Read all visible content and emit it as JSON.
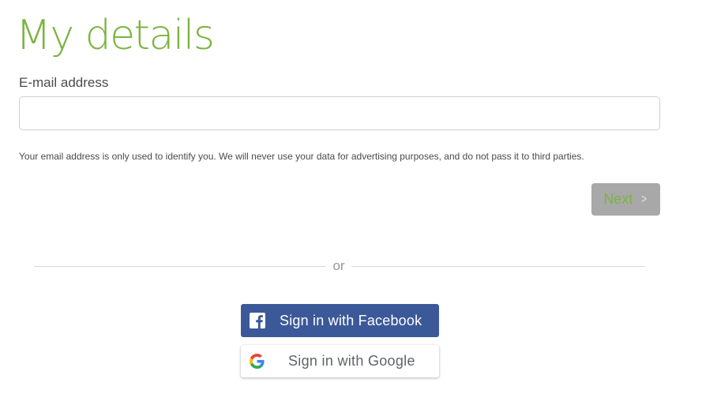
{
  "page": {
    "title": "My details"
  },
  "email": {
    "label": "E-mail address",
    "value": "",
    "placeholder": ""
  },
  "privacy_note": "Your email address is only used to identify you. We will never use your data for advertising purposes, and do not pass it to third parties.",
  "next_button": {
    "label": "Next",
    "icon": "chevron-right-icon"
  },
  "divider": {
    "text": "or"
  },
  "social": {
    "facebook": {
      "label": "Sign in with Facebook",
      "icon": "facebook-icon",
      "color": "#3b5998"
    },
    "google": {
      "label": "Sign in with Google",
      "icon": "google-icon"
    }
  },
  "colors": {
    "accent": "#7cb342",
    "next_button_bg": "#a8a8a8",
    "divider": "#d8d8d8"
  }
}
